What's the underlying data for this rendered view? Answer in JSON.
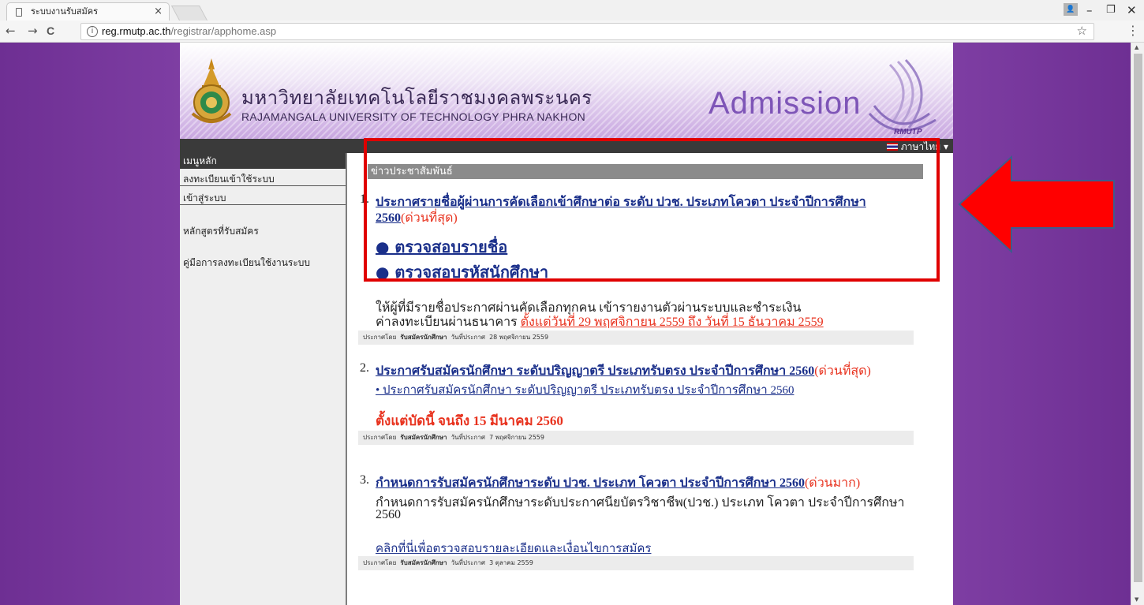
{
  "browser": {
    "tab_title": "ระบบงานรับสมัคร",
    "tab_close": "×",
    "url_domain": "reg.rmutp.ac.th",
    "url_path": "/registrar/apphome.asp",
    "back_glyph": "←",
    "forward_glyph": "→",
    "reload_glyph": "C",
    "info_glyph": "i",
    "star_glyph": "☆",
    "menu_glyph": "⋮",
    "minimize_glyph": "–",
    "restore_glyph": "❐",
    "close_glyph": "✕"
  },
  "header": {
    "thai_name": "มหาวิทยาลัยเทคโนโลยีราชมงคลพระนคร",
    "english_name": "RAJAMANGALA UNIVERSITY OF TECHNOLOGY PHRA NAKHON",
    "admission": "Admission",
    "logo_text": "RMUTP",
    "language": "ภาษาไทย ▾"
  },
  "sidebar": {
    "heading": "เมนูหลัก",
    "items": [
      "ลงทะเบียนเข้าใช้ระบบ",
      "เข้าสู่ระบบ",
      "หลักสูตรที่รับสมัคร",
      "คู่มือการลงทะเบียนใช้งานระบบ"
    ]
  },
  "news": {
    "heading": "ข่าวประชาสัมพันธ์",
    "item1": {
      "num": "1.",
      "title_line1": "ประกาศรายชื่อผู้ผ่านการคัดเลือกเข้าศึกษาต่อ ระดับ ปวช. ประเภทโควตา ประจำปีการศึกษา",
      "title_line2": "2560",
      "urgency": "(ด่วนที่สุด)",
      "link1": "● ตรวจสอบรายชื่อ",
      "link2": "● ตรวจสอบรหัสนักศึกษา",
      "body_line1": "ให้ผู้ที่มีรายชื่อประกาศผ่านคัดเลือกทุกคน เข้ารายงานตัวผ่านระบบและชำระเงิน",
      "body_line2": "ค่าลงทะเบียนผ่านธนาคาร ",
      "body_red": "ตั้งแต่วันที่ 29 พฤศจิกายน 2559 ถึง วันที่ 15 ธันวาคม 2559",
      "meta_prefix": "ประกาศโดย",
      "meta_by": "รับสมัครนักศึกษา",
      "meta_date_label": "วันที่ประกาศ",
      "meta_date": "28 พฤศจิกายน 2559"
    },
    "item2": {
      "num": "2.",
      "title": "ประกาศรับสมัครนักศึกษา ระดับปริญญาตรี ประเภทรับตรง ประจำปีการศึกษา 2560",
      "urgency": "(ด่วนที่สุด)",
      "sublink": "• ประกาศรับสมัครนักศึกษา ระดับปริญญาตรี ประเภทรับตรง ประจำปีการศึกษา 2560",
      "deadline": "ตั้งแต่บัดนี้ จนถึง 15 มีนาคม 2560",
      "meta_prefix": "ประกาศโดย",
      "meta_by": "รับสมัครนักศึกษา",
      "meta_date_label": "วันที่ประกาศ",
      "meta_date": "7 พฤศจิกายน 2559"
    },
    "item3": {
      "num": "3.",
      "title": "กำหนดการรับสมัครนักศึกษาระดับ ปวช. ประเภท โควตา ประจำปีการศึกษา 2560",
      "urgency": "(ด่วนมาก)",
      "body_line1": "กำหนดการรับสมัครนักศึกษาระดับประกาศนียบัตรวิชาชีพ(ปวช.) ประเภท โควตา ประจำปีการศึกษา",
      "body_line2": "2560",
      "sublink": "คลิกที่นี่เพื่อตรวจสอบรายละเอียดและเงื่อนไขการสมัคร",
      "meta_prefix": "ประกาศโดย",
      "meta_by": "รับสมัครนักศึกษา",
      "meta_date_label": "วันที่ประกาศ",
      "meta_date": "3 ตุลาคม 2559"
    }
  },
  "colors": {
    "purple_bg": "#7d3da2",
    "link_blue": "#1a2f8a",
    "urgent_red": "#e8321e",
    "highlight_red": "#e00000"
  }
}
